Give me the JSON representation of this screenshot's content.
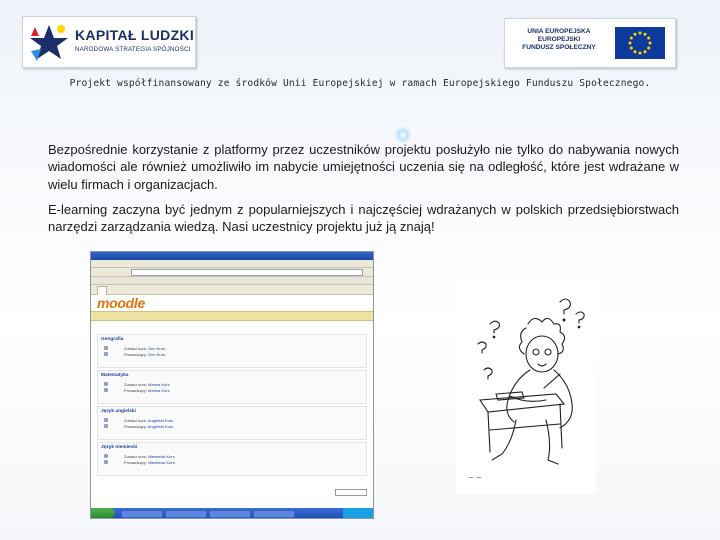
{
  "header": {
    "left_logo": {
      "title": "KAPITAŁ LUDZKI",
      "subtitle": "NARODOWA STRATEGIA SPÓJNOŚCI"
    },
    "right_logo": {
      "lines": [
        "UNIA EUROPEJSKA",
        "EUROPEJSKI",
        "FUNDUSZ SPOŁECZNY"
      ]
    },
    "cofinance": "Projekt współfinansowany ze środków Unii Europejskiej w ramach Europejskiego Funduszu Społecznego."
  },
  "body": {
    "paragraph1": "Bezpośrednie korzystanie z platformy przez uczestników projektu posłużyło nie tylko do nabywania nowych wiadomości ale również umożliwiło im nabycie umiejętności uczenia się na odległość, które jest wdrażane w wielu firmach i organizacjach.",
    "paragraph2": "E-learning zaczyna być jednym z popularniejszych i najczęściej wdrażanych w polskich przedsiębiorstwach narzędzi zarządzania wiedzą. Nasi uczestnicy projektu już ją znają!"
  },
  "screenshot": {
    "logo": "moodle",
    "categories": [
      {
        "name": "Geografia",
        "row1": "Zobacz kurs:",
        "link1": "Geo Kurs",
        "row2": "Prowadzący:",
        "link2": "Geo Kurs"
      },
      {
        "name": "Matematyka",
        "row1": "Zobacz kurs:",
        "link1": "Matma Kurs",
        "row2": "Prowadzący:",
        "link2": "Matma Kurs"
      },
      {
        "name": "Język angielski",
        "row1": "Zobacz kurs:",
        "link1": "Angielski Kurs",
        "row2": "Prowadzący:",
        "link2": "Angielski Kurs"
      },
      {
        "name": "Język niemiecki",
        "row1": "Zobacz kurs:",
        "link1": "Niemiecki Kurs",
        "row2": "Prowadzący:",
        "link2": "Niemiecki Kurs"
      }
    ]
  },
  "colors": {
    "brand_navy": "#1c2f6b",
    "eu_blue": "#0d3a9b",
    "eu_star": "#ffd500",
    "moodle_orange": "#e5720f"
  }
}
